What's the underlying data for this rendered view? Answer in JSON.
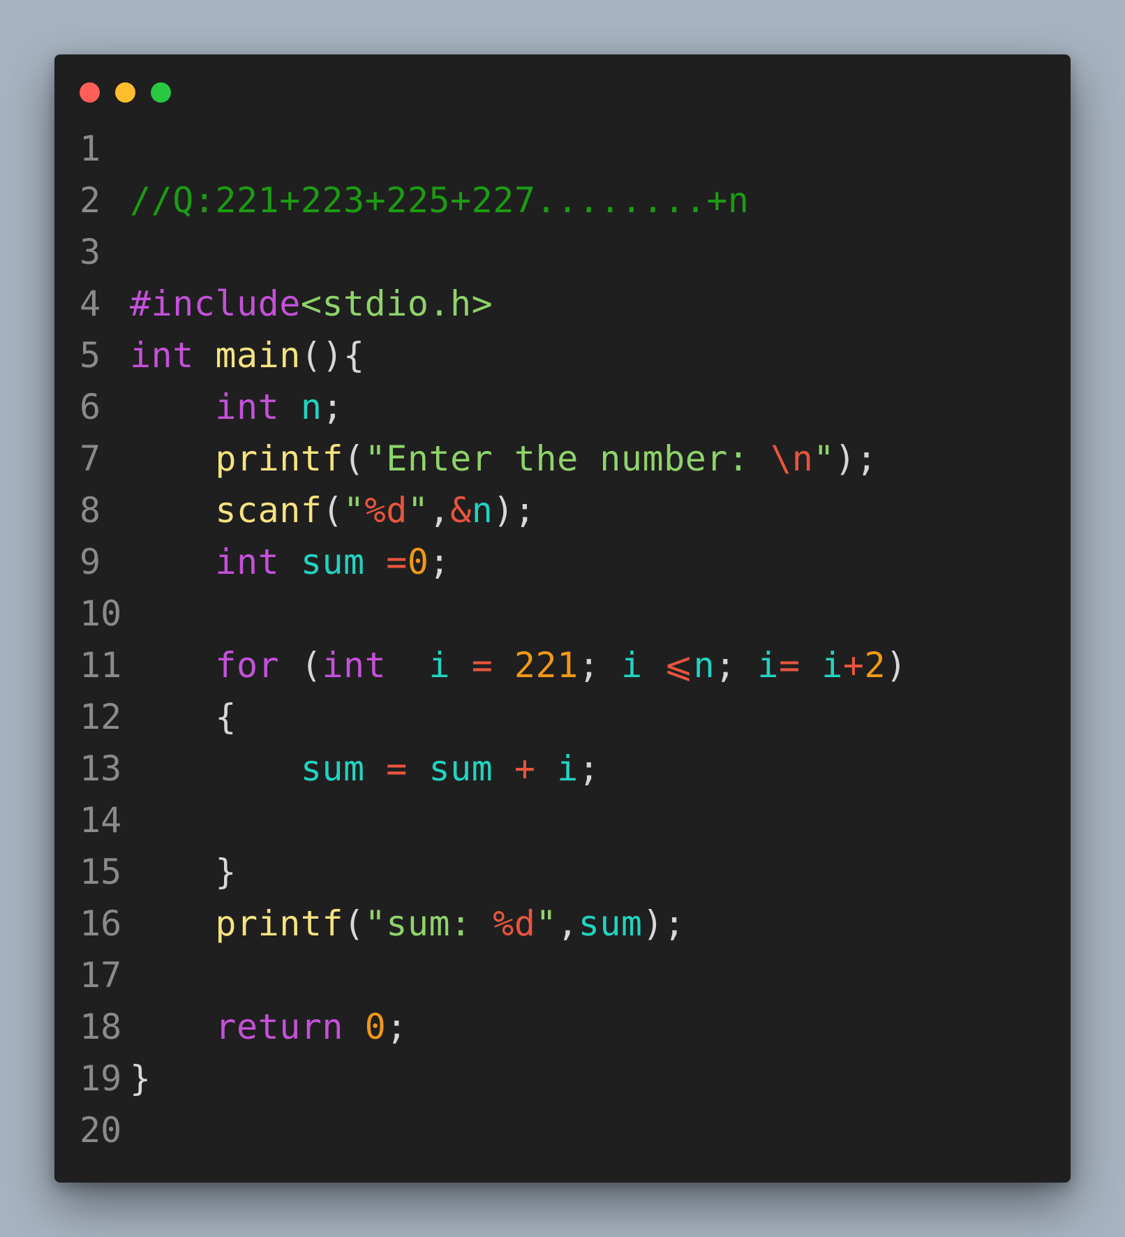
{
  "window": {
    "traffic_lights": {
      "close_color": "#ff5f57",
      "minimize_color": "#ffbd2e",
      "maximize_color": "#28c840"
    }
  },
  "colors": {
    "comment": "#1c9b12",
    "keyword": "#c451d9",
    "function": "#f6e27f",
    "string": "#8fd36a",
    "variable": "#22d3c0",
    "number": "#f09818",
    "operator": "#e8553e",
    "plain": "#d7d7d7",
    "line_number": "#8a8a8a"
  },
  "code_lines": [
    {
      "number": "1",
      "tokens": []
    },
    {
      "number": "2",
      "tokens": [
        {
          "t": "//Q:221+223+225+227........+n",
          "c": "comment"
        }
      ]
    },
    {
      "number": "3",
      "tokens": []
    },
    {
      "number": "4",
      "tokens": [
        {
          "t": "#include",
          "c": "keyword"
        },
        {
          "t": "<stdio.h>",
          "c": "string"
        }
      ]
    },
    {
      "number": "5",
      "tokens": [
        {
          "t": "int",
          "c": "keyword"
        },
        {
          "t": " ",
          "c": "plain"
        },
        {
          "t": "main",
          "c": "function"
        },
        {
          "t": "(){",
          "c": "plain"
        }
      ]
    },
    {
      "number": "6",
      "tokens": [
        {
          "t": "    ",
          "c": "plain"
        },
        {
          "t": "int",
          "c": "keyword"
        },
        {
          "t": " ",
          "c": "plain"
        },
        {
          "t": "n",
          "c": "variable"
        },
        {
          "t": ";",
          "c": "plain"
        }
      ]
    },
    {
      "number": "7",
      "tokens": [
        {
          "t": "    ",
          "c": "plain"
        },
        {
          "t": "printf",
          "c": "function"
        },
        {
          "t": "(",
          "c": "plain"
        },
        {
          "t": "\"Enter the number: ",
          "c": "string"
        },
        {
          "t": "\\n",
          "c": "operator"
        },
        {
          "t": "\"",
          "c": "string"
        },
        {
          "t": ");",
          "c": "plain"
        }
      ]
    },
    {
      "number": "8",
      "tokens": [
        {
          "t": "    ",
          "c": "plain"
        },
        {
          "t": "scanf",
          "c": "function"
        },
        {
          "t": "(",
          "c": "plain"
        },
        {
          "t": "\"",
          "c": "string"
        },
        {
          "t": "%d",
          "c": "operator"
        },
        {
          "t": "\"",
          "c": "string"
        },
        {
          "t": ",",
          "c": "plain"
        },
        {
          "t": "&",
          "c": "operator"
        },
        {
          "t": "n",
          "c": "variable"
        },
        {
          "t": ");",
          "c": "plain"
        }
      ]
    },
    {
      "number": "9",
      "tokens": [
        {
          "t": "    ",
          "c": "plain"
        },
        {
          "t": "int",
          "c": "keyword"
        },
        {
          "t": " ",
          "c": "plain"
        },
        {
          "t": "sum",
          "c": "variable"
        },
        {
          "t": " ",
          "c": "plain"
        },
        {
          "t": "=",
          "c": "operator"
        },
        {
          "t": "0",
          "c": "number"
        },
        {
          "t": ";",
          "c": "plain"
        }
      ]
    },
    {
      "number": "10",
      "tokens": []
    },
    {
      "number": "11",
      "tokens": [
        {
          "t": "    ",
          "c": "plain"
        },
        {
          "t": "for",
          "c": "keyword"
        },
        {
          "t": " (",
          "c": "plain"
        },
        {
          "t": "int",
          "c": "keyword"
        },
        {
          "t": "  ",
          "c": "plain"
        },
        {
          "t": "i",
          "c": "variable"
        },
        {
          "t": " ",
          "c": "plain"
        },
        {
          "t": "=",
          "c": "operator"
        },
        {
          "t": " ",
          "c": "plain"
        },
        {
          "t": "221",
          "c": "number"
        },
        {
          "t": "; ",
          "c": "plain"
        },
        {
          "t": "i",
          "c": "variable"
        },
        {
          "t": " ",
          "c": "plain"
        },
        {
          "t": "⩽",
          "c": "operator"
        },
        {
          "t": "n",
          "c": "variable"
        },
        {
          "t": "; ",
          "c": "plain"
        },
        {
          "t": "i",
          "c": "variable"
        },
        {
          "t": "=",
          "c": "operator"
        },
        {
          "t": " ",
          "c": "plain"
        },
        {
          "t": "i",
          "c": "variable"
        },
        {
          "t": "+",
          "c": "operator"
        },
        {
          "t": "2",
          "c": "number"
        },
        {
          "t": ")",
          "c": "plain"
        }
      ]
    },
    {
      "number": "12",
      "tokens": [
        {
          "t": "    {",
          "c": "plain"
        }
      ]
    },
    {
      "number": "13",
      "tokens": [
        {
          "t": "        ",
          "c": "plain"
        },
        {
          "t": "sum",
          "c": "variable"
        },
        {
          "t": " ",
          "c": "plain"
        },
        {
          "t": "=",
          "c": "operator"
        },
        {
          "t": " ",
          "c": "plain"
        },
        {
          "t": "sum",
          "c": "variable"
        },
        {
          "t": " ",
          "c": "plain"
        },
        {
          "t": "+",
          "c": "operator"
        },
        {
          "t": " ",
          "c": "plain"
        },
        {
          "t": "i",
          "c": "variable"
        },
        {
          "t": ";",
          "c": "plain"
        }
      ]
    },
    {
      "number": "14",
      "tokens": []
    },
    {
      "number": "15",
      "tokens": [
        {
          "t": "    }",
          "c": "plain"
        }
      ]
    },
    {
      "number": "16",
      "tokens": [
        {
          "t": "    ",
          "c": "plain"
        },
        {
          "t": "printf",
          "c": "function"
        },
        {
          "t": "(",
          "c": "plain"
        },
        {
          "t": "\"sum: ",
          "c": "string"
        },
        {
          "t": "%d",
          "c": "operator"
        },
        {
          "t": "\"",
          "c": "string"
        },
        {
          "t": ",",
          "c": "plain"
        },
        {
          "t": "sum",
          "c": "variable"
        },
        {
          "t": ");",
          "c": "plain"
        }
      ]
    },
    {
      "number": "17",
      "tokens": []
    },
    {
      "number": "18",
      "tokens": [
        {
          "t": "    ",
          "c": "plain"
        },
        {
          "t": "return",
          "c": "keyword"
        },
        {
          "t": " ",
          "c": "plain"
        },
        {
          "t": "0",
          "c": "number"
        },
        {
          "t": ";",
          "c": "plain"
        }
      ]
    },
    {
      "number": "19",
      "tokens": [
        {
          "t": "}",
          "c": "plain"
        }
      ]
    },
    {
      "number": "20",
      "tokens": []
    }
  ]
}
